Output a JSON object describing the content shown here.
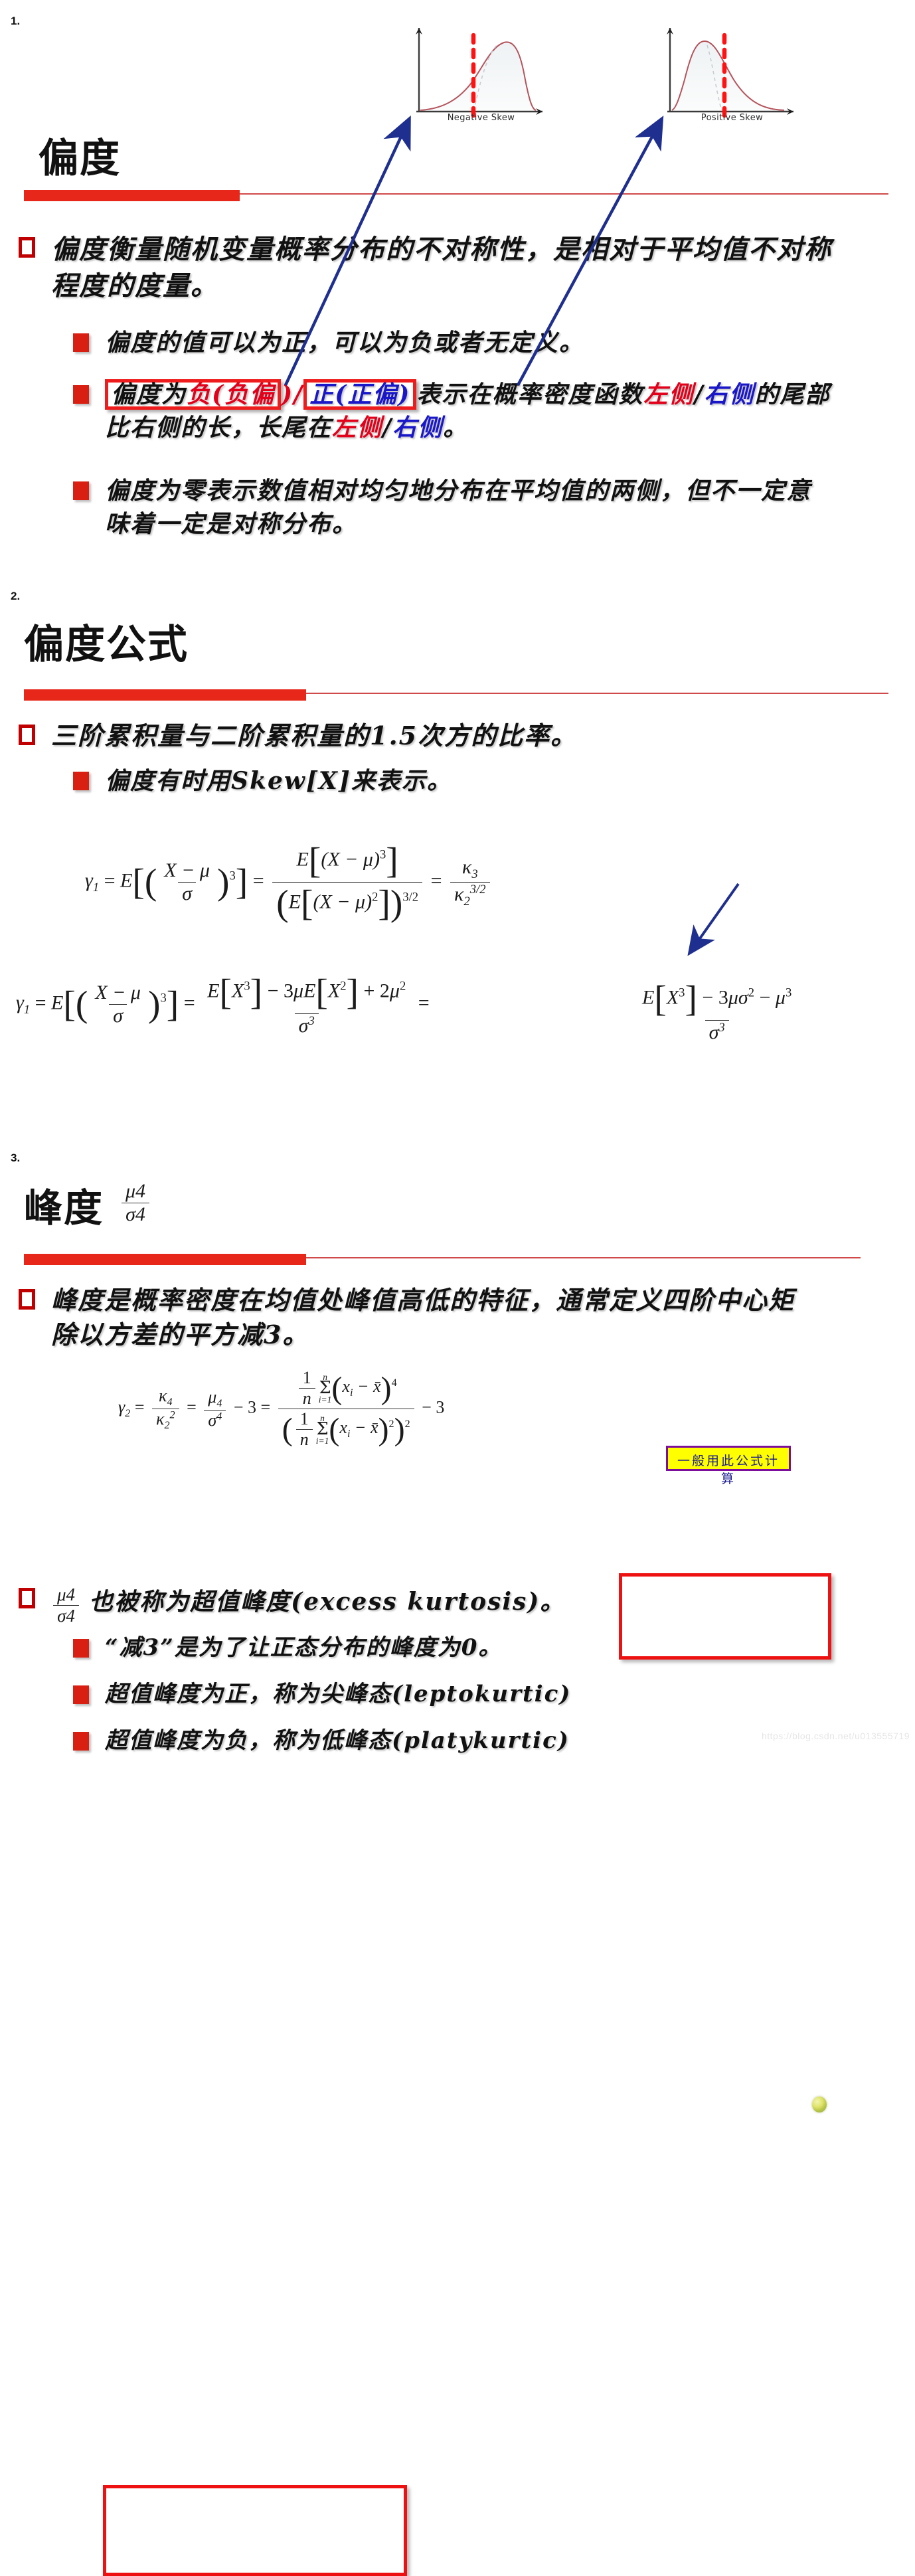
{
  "slides": [
    {
      "number": "1.",
      "title": "偏度",
      "bullets": {
        "b1": "偏度衡量随机变量概率分布的不对称性，是相对于平均值不对称程度的度量。",
        "b2": "偏度的值可以为正，可以为负或者无定义。",
        "b3_pre": "偏度为",
        "b3_neg": "负(负偏",
        "b3_slash": ")/",
        "b3_pos": "正(正偏)",
        "b3_mid": "表示在概率密度函数",
        "b3_left1": "左侧",
        "b3_sep1": "/",
        "b3_right1": "右侧",
        "b3_mid2": "的尾部比右侧的长，长尾在",
        "b3_left2": "左侧",
        "b3_sep2": "/",
        "b3_right2": "右侧",
        "b3_end": "。",
        "b4": "偏度为零表示数值相对均匀地分布在平均值的两侧，但不一定意味着一定是对称分布。"
      },
      "charts": [
        {
          "caption": "Negative Skew",
          "type": "density-curve",
          "skew": "negative"
        },
        {
          "caption": "Positive Skew",
          "type": "density-curve",
          "skew": "positive"
        }
      ]
    },
    {
      "number": "2.",
      "title": "偏度公式",
      "bullets": {
        "b1": "三阶累积量与二阶累积量的1.5次方的比率。",
        "b2": "偏度有时用Skew[X]来表示。"
      },
      "callout": "一般用此公式计算",
      "formula_row1": "γ1 = E[((X − μ)/σ)^3] = E[(X − μ)^3] / (E[(X − μ)^2])^(3/2) = κ3 / κ2^(3/2)",
      "formula_row2": "γ1 = E[((X − μ)/σ)^3] = (E[X^3] − 3μE[X^2] + 2μ^2)/σ^3 = (E[X^3] − 3μσ^2 − μ^3)/σ^3"
    },
    {
      "number": "3.",
      "title": "峰度",
      "title_frac_num": "μ4",
      "title_frac_den": "σ4",
      "bullets": {
        "b1": "峰度是概率密度在均值处峰值高低的特征，通常定义四阶中心矩除以方差的平方减3。",
        "b2_tail": "也被称为超值峰度(excess kurtosis)。",
        "b3": "“减3”是为了让正态分布的峰度为0。",
        "b4": "超值峰度为正，称为尖峰态(leptokurtic)",
        "b5": "超值峰度为负，称为低峰态(platykurtic)"
      },
      "formula": "γ2 = κ4/κ2^2 = μ4/σ^4 − 3 = ( (1/n)Σ(xi − x̄)^4 ) / ( (1/n)Σ(xi − x̄)^2 )^2 − 3"
    }
  ],
  "watermark": "https://blog.csdn.net/u013555719",
  "colors": {
    "accent_red": "#e8271b",
    "box_red": "#ee1c1c",
    "text_red": "#e2001a",
    "text_blue": "#1a17c8",
    "callout_bg": "#ffff00",
    "callout_border": "#7b0f9b",
    "callout_text": "#1b1b8f",
    "arrow_blue": "#1f2f8f",
    "curve": "#b5535c"
  }
}
